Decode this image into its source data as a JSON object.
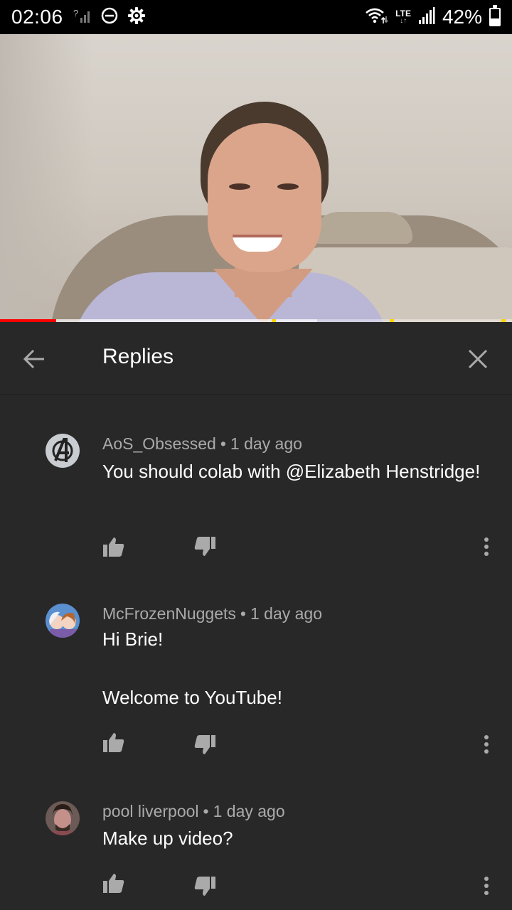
{
  "status_bar": {
    "time": "02:06",
    "battery_percent": "42%",
    "battery_level": 0.42,
    "network_label": "LTE",
    "icons": [
      "no-sim-signal-icon",
      "do-not-disturb-icon",
      "settings-gear-icon",
      "wifi-icon",
      "lte-icon",
      "cell-signal-icon",
      "battery-icon"
    ]
  },
  "video": {
    "progress_played": 0.11,
    "progress_buffered": 0.62
  },
  "replies_panel": {
    "title": "Replies",
    "back_icon": "arrow-back-icon",
    "close_icon": "close-icon"
  },
  "comments": [
    {
      "author": "AoS_Obsessed",
      "separator": "•",
      "time": "1 day ago",
      "text": "You should colab with @Elizabeth Henstridge!",
      "avatar_icon": "avengers-logo-avatar"
    },
    {
      "author": "McFrozenNuggets",
      "separator": "•",
      "time": "1 day ago",
      "text_line1": "Hi Brie!",
      "text_line2": "Welcome to YouTube!",
      "avatar_icon": "frozen-characters-avatar"
    },
    {
      "author": "pool liverpool",
      "separator": "•",
      "time": "1 day ago",
      "text": "Make up video?",
      "avatar_icon": "person-photo-avatar"
    }
  ],
  "colors": {
    "background": "#282828",
    "status_bar": "#000000",
    "meta_text": "#aaaaaa",
    "progress_red": "#ff0000"
  }
}
